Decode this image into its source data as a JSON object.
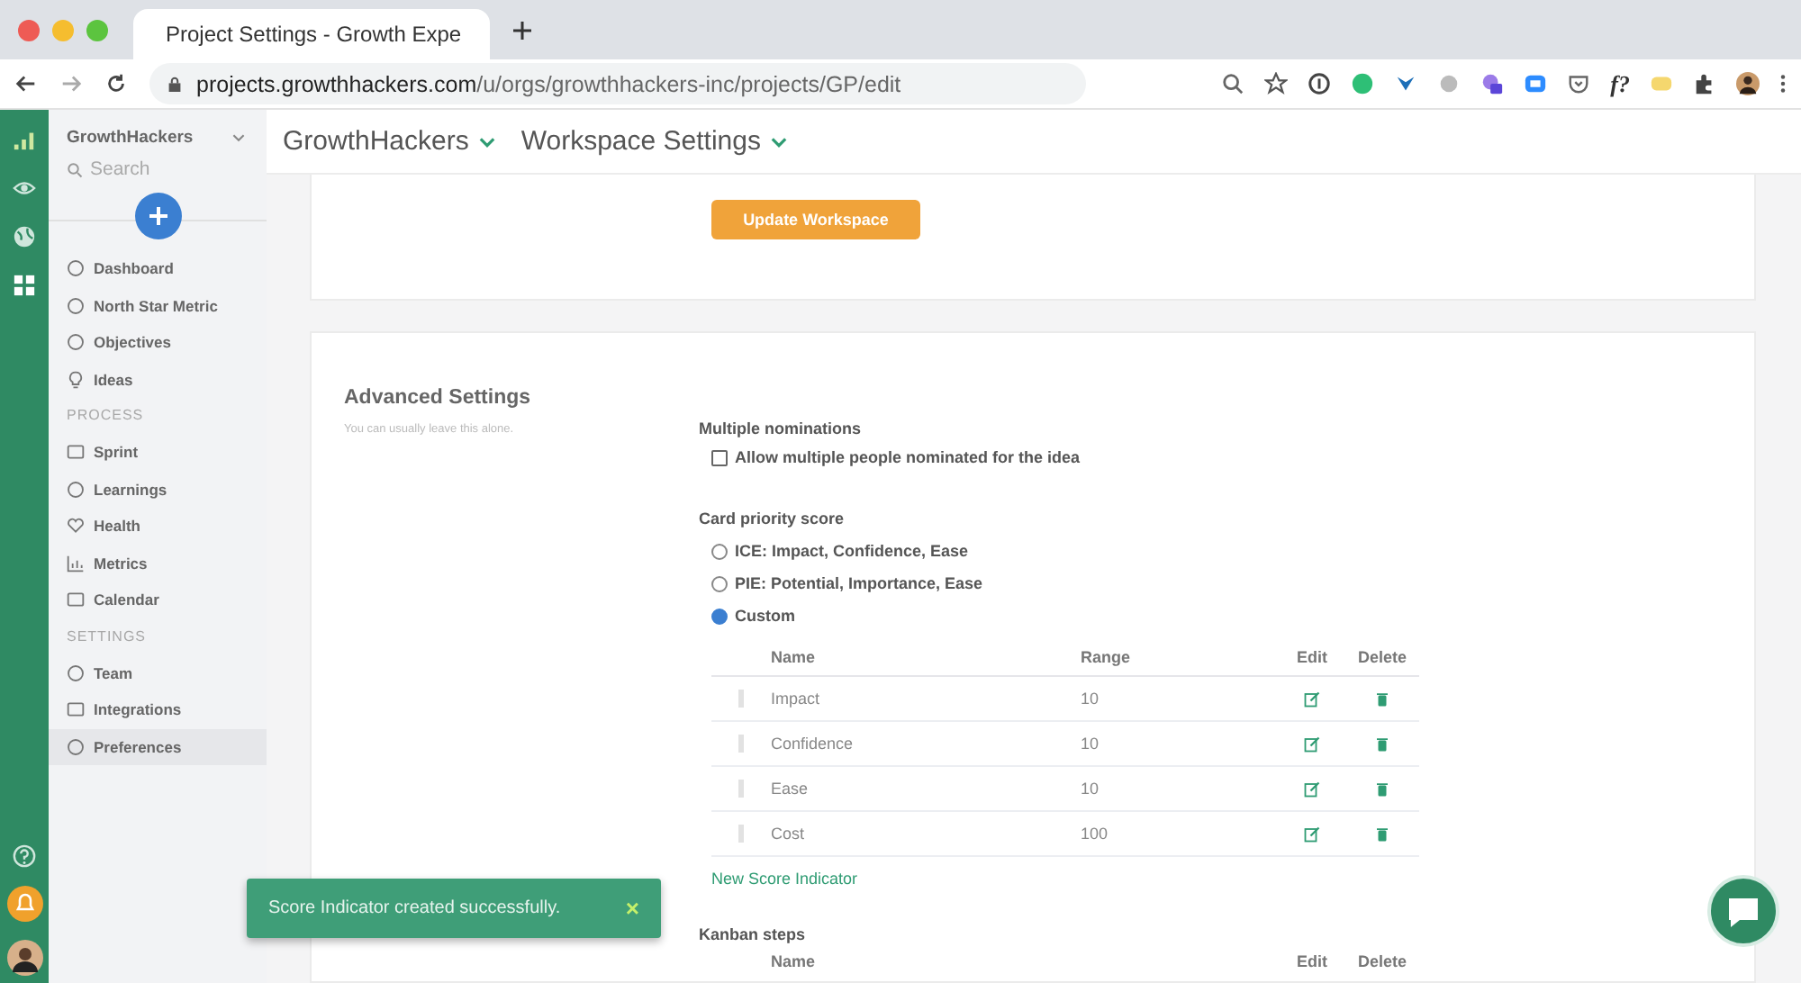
{
  "browser": {
    "tab_title": "Project Settings - Growth Expe",
    "url_host": "projects.growthhackers.com",
    "url_path": "/u/orgs/growthhackers-inc/projects/GP/edit",
    "extension_label": "f?"
  },
  "sidebar": {
    "org": "GrowthHackers",
    "search_placeholder": "Search",
    "items": [
      {
        "kind": "item",
        "label": "Dashboard",
        "selected": false
      },
      {
        "kind": "item",
        "label": "North Star Metric",
        "selected": false
      },
      {
        "kind": "item",
        "label": "Objectives",
        "selected": false
      },
      {
        "kind": "item",
        "label": "Ideas",
        "selected": false
      },
      {
        "kind": "section",
        "label": "PROCESS"
      },
      {
        "kind": "item",
        "label": "Sprint",
        "selected": false
      },
      {
        "kind": "item",
        "label": "Learnings",
        "selected": false
      },
      {
        "kind": "item",
        "label": "Health",
        "selected": false
      },
      {
        "kind": "item",
        "label": "Metrics",
        "selected": false
      },
      {
        "kind": "item",
        "label": "Calendar",
        "selected": false
      },
      {
        "kind": "section",
        "label": "SETTINGS"
      },
      {
        "kind": "item",
        "label": "Team",
        "selected": false
      },
      {
        "kind": "item",
        "label": "Integrations",
        "selected": false
      },
      {
        "kind": "item",
        "label": "Preferences",
        "selected": true
      }
    ]
  },
  "header": {
    "breadcrumbs": [
      "GrowthHackers",
      "Workspace Settings"
    ]
  },
  "update_button": "Update Workspace",
  "advanced": {
    "title": "Advanced Settings",
    "subtitle": "You can usually leave this alone.",
    "nominations": {
      "label": "Multiple nominations",
      "option": "Allow multiple people nominated for the idea",
      "checked": false
    },
    "priority": {
      "label": "Card priority score",
      "options": [
        {
          "label": "ICE: Impact, Confidence, Ease",
          "selected": false
        },
        {
          "label": "PIE: Potential, Importance, Ease",
          "selected": false
        },
        {
          "label": "Custom",
          "selected": true
        }
      ]
    },
    "indicators": {
      "columns": [
        "Name",
        "Range",
        "Edit",
        "Delete"
      ],
      "rows": [
        {
          "name": "Impact",
          "range": "10"
        },
        {
          "name": "Confidence",
          "range": "10"
        },
        {
          "name": "Ease",
          "range": "10"
        },
        {
          "name": "Cost",
          "range": "100"
        }
      ],
      "new_link": "New Score Indicator"
    },
    "kanban": {
      "label": "Kanban steps",
      "columns": [
        "Name",
        "Edit",
        "Delete"
      ]
    }
  },
  "toast": {
    "message": "Score Indicator created successfully.",
    "close": "×"
  }
}
